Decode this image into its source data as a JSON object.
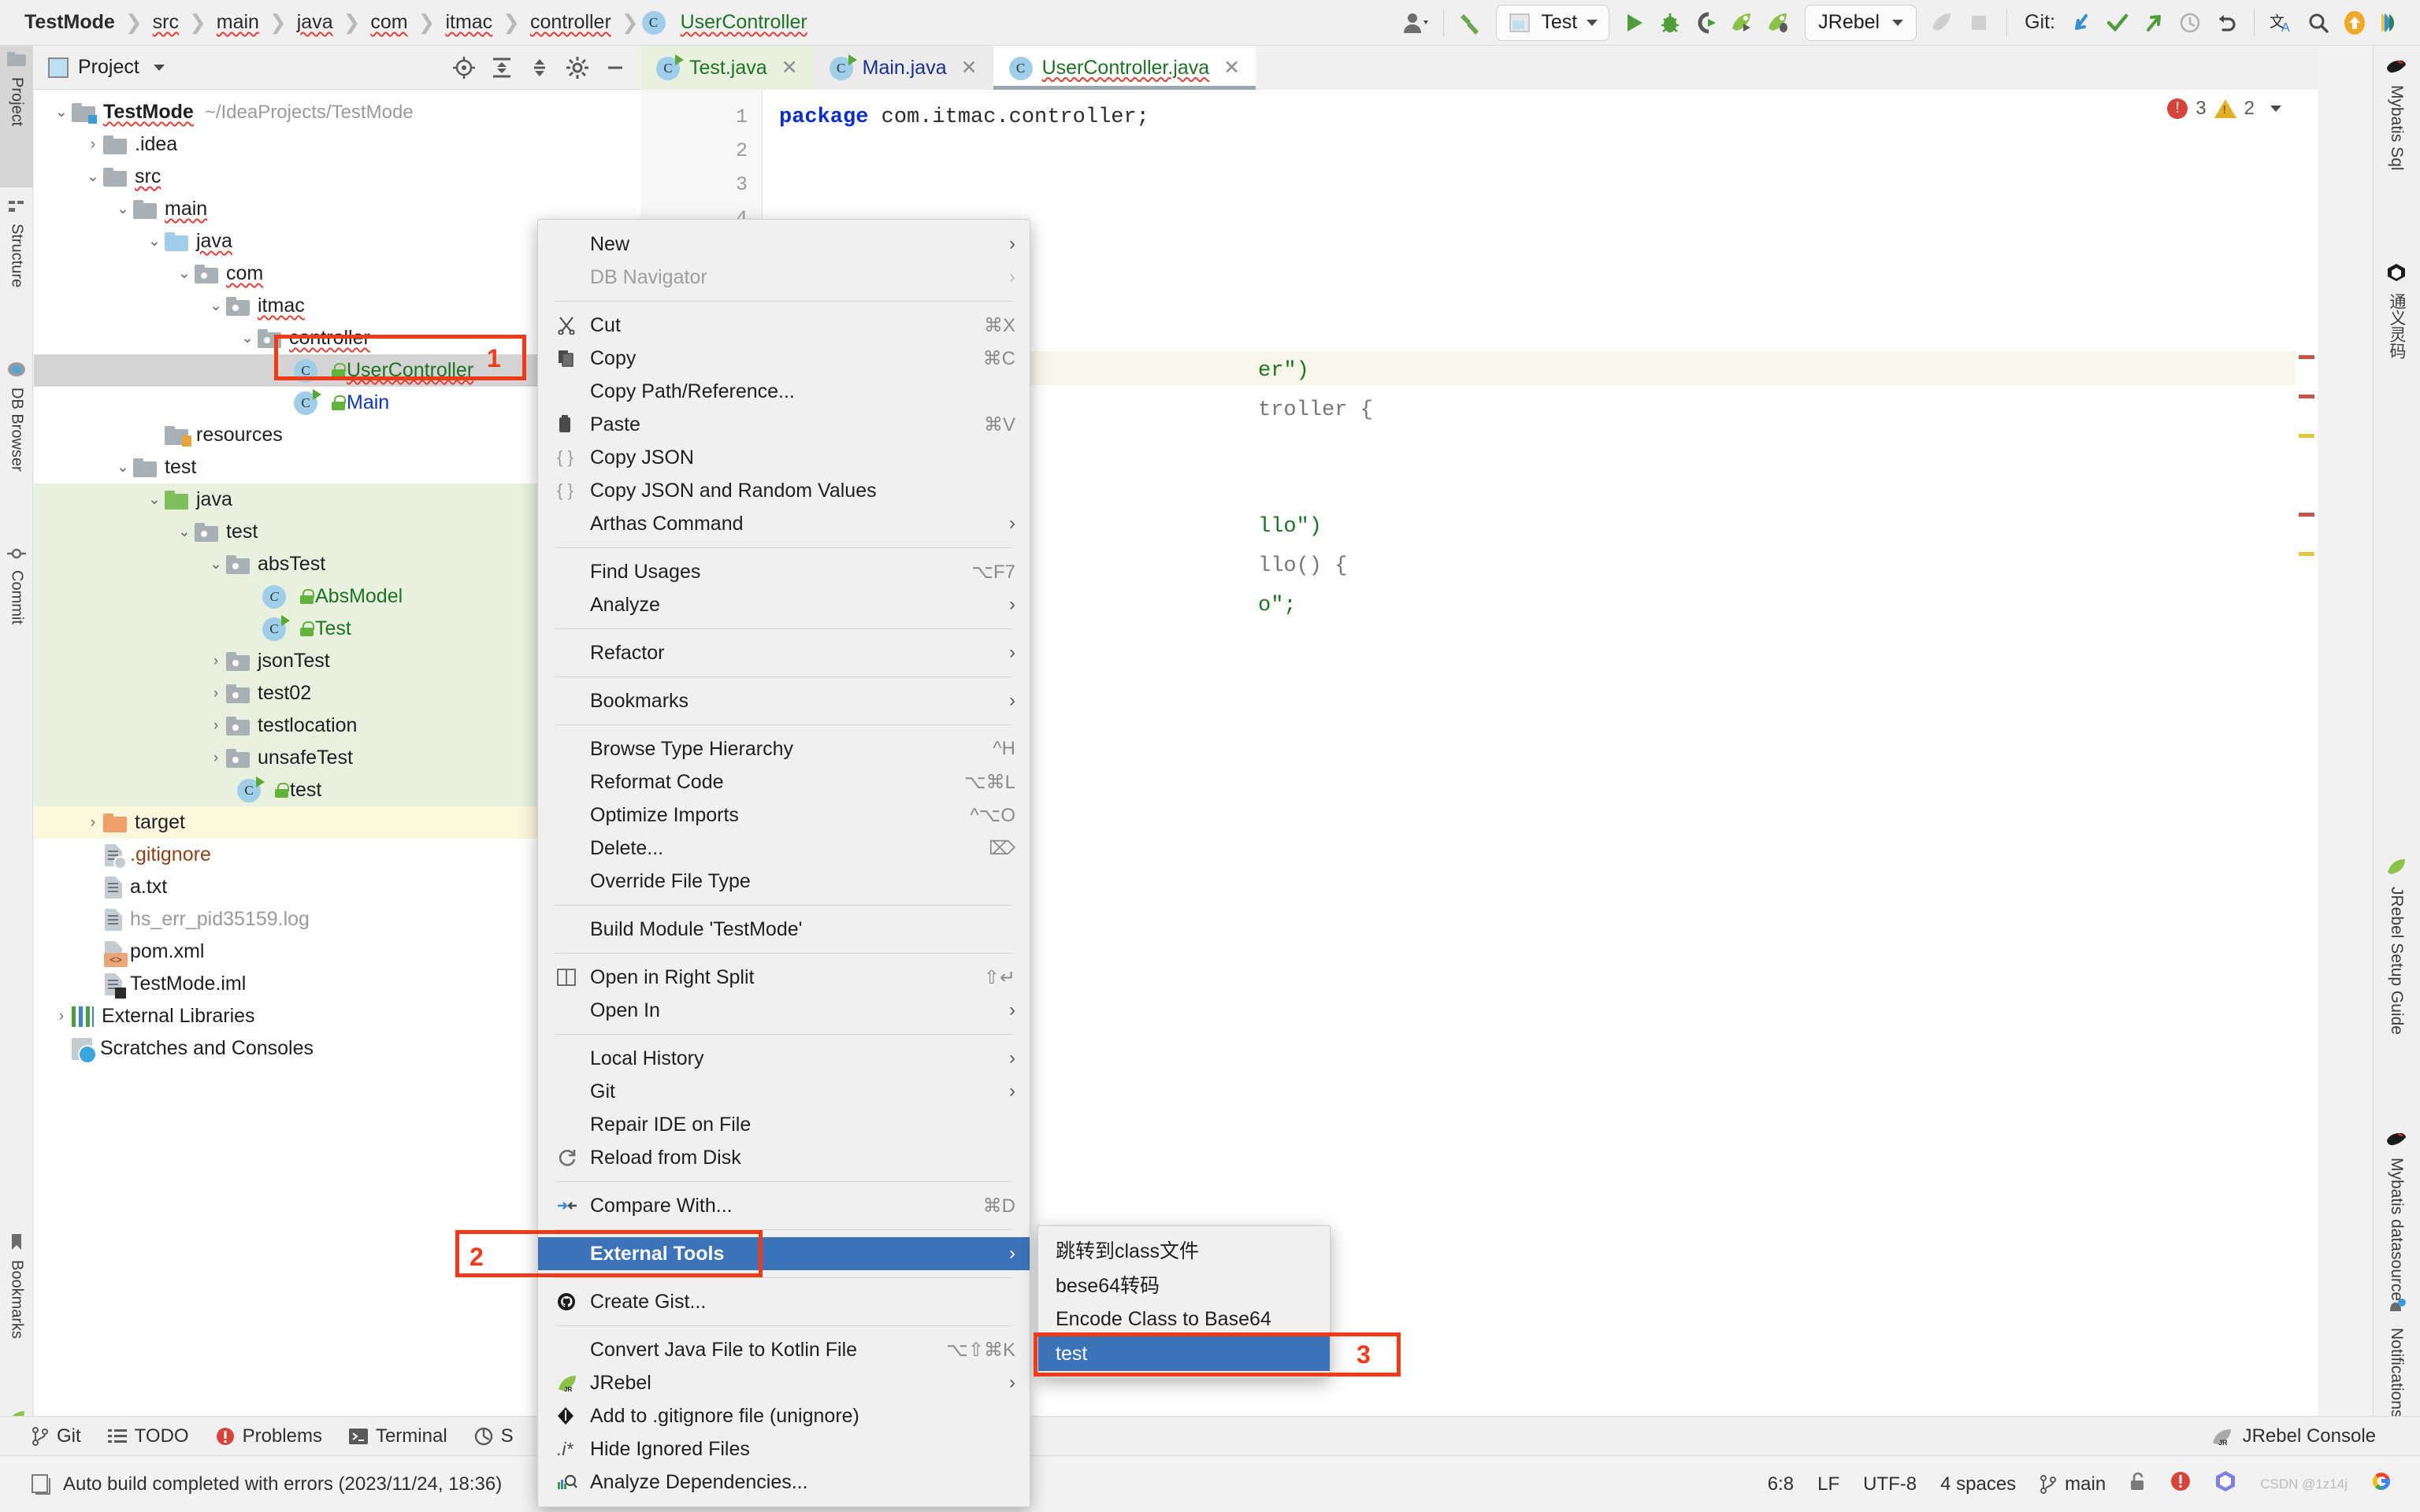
{
  "breadcrumbs": [
    {
      "label": "TestMode",
      "style": "project"
    },
    {
      "label": "src",
      "style": "squig"
    },
    {
      "label": "main",
      "style": "squig"
    },
    {
      "label": "java",
      "style": "squig"
    },
    {
      "label": "com",
      "style": "squig"
    },
    {
      "label": "itmac",
      "style": "squig"
    },
    {
      "label": "controller",
      "style": "squig"
    },
    {
      "label": "UserController",
      "style": "green-squig"
    }
  ],
  "toolbar": {
    "run_config_label": "Test",
    "jrebel_label": "JRebel",
    "git_label": "Git:",
    "icons": [
      "user-avatar-icon",
      "hammer-build-icon",
      "run-config-icon",
      "run-icon",
      "debug-icon",
      "run-coverage-icon",
      "jrebel-run-icon",
      "jrebel-debug-icon",
      "jrebel-disabled-icon",
      "stop-icon",
      "git-update-icon",
      "git-commit-icon",
      "git-push-icon",
      "git-history-icon",
      "git-rollback-icon",
      "translate-icon",
      "search-everywhere-icon",
      "update-available-icon",
      "ide-feature-icon"
    ]
  },
  "left_rail": [
    {
      "label": "Project",
      "icon": "project-icon",
      "selected": true
    },
    {
      "label": "Structure",
      "icon": "structure-icon",
      "selected": false
    },
    {
      "label": "DB Browser",
      "icon": "db-browser-icon",
      "selected": false
    },
    {
      "label": "Commit",
      "icon": "commit-icon",
      "selected": false
    },
    {
      "label": "Bookmarks",
      "icon": "bookmarks-icon",
      "selected": false
    },
    {
      "label": "JRebel",
      "icon": "jrebel-icon",
      "selected": false
    }
  ],
  "right_rail": [
    {
      "label": "Mybatis Sql",
      "icon": "mybatis-icon"
    },
    {
      "label": "通义灵码",
      "icon": "tongyi-icon"
    },
    {
      "label": "JRebel Setup Guide",
      "icon": "jrebel-icon"
    },
    {
      "label": "Mybatis datasource",
      "icon": "mybatis-icon"
    },
    {
      "label": "Notifications",
      "icon": "notifications-icon"
    }
  ],
  "project_panel": {
    "title": "Project",
    "header_icons": [
      "locate-icon",
      "expand-all-icon",
      "collapse-all-icon",
      "settings-icon",
      "hide-icon",
      "more-options-icon"
    ],
    "tree": [
      {
        "depth": 0,
        "label": "TestMode",
        "suffix": "~/IdeaProjects/TestMode",
        "icon": "project-folder-icon",
        "arrow": "down",
        "style": "bold-squig",
        "band": "none"
      },
      {
        "depth": 1,
        "label": ".idea",
        "icon": "folder-icon",
        "arrow": "right",
        "style": "plain",
        "band": "none"
      },
      {
        "depth": 1,
        "label": "src",
        "icon": "folder-icon",
        "arrow": "down",
        "style": "squig",
        "band": "none"
      },
      {
        "depth": 2,
        "label": "main",
        "icon": "folder-icon",
        "arrow": "down",
        "style": "squig",
        "band": "none"
      },
      {
        "depth": 3,
        "label": "java",
        "icon": "source-folder-icon",
        "arrow": "down",
        "style": "squig",
        "band": "none"
      },
      {
        "depth": 4,
        "label": "com",
        "icon": "package-icon",
        "arrow": "down",
        "style": "squig",
        "band": "none"
      },
      {
        "depth": 5,
        "label": "itmac",
        "icon": "package-icon",
        "arrow": "down",
        "style": "squig",
        "band": "none"
      },
      {
        "depth": 6,
        "label": "controller",
        "icon": "package-icon",
        "arrow": "down",
        "style": "squig",
        "band": "none"
      },
      {
        "depth": 7,
        "label": "UserController",
        "icon": "java-class-icon",
        "arrow": "none",
        "style": "green-squig",
        "band": "selected"
      },
      {
        "depth": 7,
        "label": "Main",
        "icon": "java-runnable-class-icon",
        "arrow": "none",
        "style": "blue",
        "band": "none"
      },
      {
        "depth": 3,
        "label": "resources",
        "icon": "resources-folder-icon",
        "arrow": "none",
        "style": "plain",
        "band": "none"
      },
      {
        "depth": 2,
        "label": "test",
        "icon": "folder-icon",
        "arrow": "down",
        "style": "plain",
        "band": "none"
      },
      {
        "depth": 3,
        "label": "java",
        "icon": "test-source-folder-icon",
        "arrow": "down",
        "style": "plain",
        "band": "green"
      },
      {
        "depth": 4,
        "label": "test",
        "icon": "package-icon",
        "arrow": "down",
        "style": "plain",
        "band": "green"
      },
      {
        "depth": 5,
        "label": "absTest",
        "icon": "package-icon",
        "arrow": "down",
        "style": "plain",
        "band": "green"
      },
      {
        "depth": 6,
        "label": "AbsModel",
        "icon": "abstract-class-icon",
        "arrow": "none",
        "style": "green",
        "band": "green"
      },
      {
        "depth": 6,
        "label": "Test",
        "icon": "java-runnable-class-icon",
        "arrow": "none",
        "style": "green",
        "band": "green"
      },
      {
        "depth": 5,
        "label": "jsonTest",
        "icon": "package-icon",
        "arrow": "right",
        "style": "plain",
        "band": "green"
      },
      {
        "depth": 5,
        "label": "test02",
        "icon": "package-icon",
        "arrow": "right",
        "style": "plain",
        "band": "green"
      },
      {
        "depth": 5,
        "label": "testlocation",
        "icon": "package-icon",
        "arrow": "right",
        "style": "plain",
        "band": "green"
      },
      {
        "depth": 5,
        "label": "unsafeTest",
        "icon": "package-icon",
        "arrow": "right",
        "style": "plain",
        "band": "green"
      },
      {
        "depth": 5,
        "label": "test",
        "icon": "java-runnable-class-icon",
        "arrow": "none",
        "style": "plain",
        "band": "green"
      },
      {
        "depth": 1,
        "label": "target",
        "icon": "target-folder-icon",
        "arrow": "right",
        "style": "plain",
        "band": "yellow"
      },
      {
        "depth": 1,
        "label": ".gitignore",
        "icon": "gitignore-file-icon",
        "arrow": "none",
        "style": "brown",
        "band": "none"
      },
      {
        "depth": 1,
        "label": "a.txt",
        "icon": "text-file-icon",
        "arrow": "none",
        "style": "plain",
        "band": "none"
      },
      {
        "depth": 1,
        "label": "hs_err_pid35159.log",
        "icon": "log-file-icon",
        "arrow": "none",
        "style": "grey",
        "band": "none"
      },
      {
        "depth": 1,
        "label": "pom.xml",
        "icon": "maven-file-icon",
        "arrow": "none",
        "style": "plain",
        "band": "none"
      },
      {
        "depth": 1,
        "label": "TestMode.iml",
        "icon": "iml-file-icon",
        "arrow": "none",
        "style": "plain",
        "band": "none"
      },
      {
        "depth": 0,
        "label": "External Libraries",
        "icon": "libraries-icon",
        "arrow": "right",
        "style": "plain",
        "band": "none"
      },
      {
        "depth": 0,
        "label": "Scratches and Consoles",
        "icon": "scratches-icon",
        "arrow": "none",
        "style": "plain",
        "band": "none"
      }
    ]
  },
  "editor": {
    "tabs": [
      {
        "label": "Test.java",
        "icon": "java-runnable-class-icon",
        "state": "green",
        "active": false
      },
      {
        "label": "Main.java",
        "icon": "java-runnable-class-icon",
        "state": "blue",
        "active": false
      },
      {
        "label": "UserController.java",
        "icon": "java-class-icon",
        "state": "green-squig",
        "active": true
      }
    ],
    "line_numbers": [
      "1",
      "2",
      "3",
      "4"
    ],
    "code_lines": [
      {
        "text": "package com.itmac.controller;",
        "kw": "package"
      },
      {
        "text": "er\")"
      },
      {
        "text": "troller {"
      },
      {
        "text": "llo\")"
      },
      {
        "text": "llo() {"
      },
      {
        "text": "o\";"
      }
    ],
    "inspection": {
      "errors": "3",
      "warnings": "2"
    }
  },
  "context_menu": {
    "items": [
      {
        "label": "New",
        "submenu": true,
        "icon": "",
        "accel": "",
        "disabled": false
      },
      {
        "label": "DB Navigator",
        "submenu": true,
        "icon": "",
        "accel": "",
        "disabled": true
      },
      {
        "sep": true
      },
      {
        "label": "Cut",
        "submenu": false,
        "icon": "scissors-icon",
        "accel": "⌘X",
        "disabled": false
      },
      {
        "label": "Copy",
        "submenu": false,
        "icon": "copy-icon",
        "accel": "⌘C",
        "disabled": false
      },
      {
        "label": "Copy Path/Reference...",
        "submenu": false,
        "icon": "",
        "accel": "",
        "disabled": false
      },
      {
        "label": "Paste",
        "submenu": false,
        "icon": "clipboard-icon",
        "accel": "⌘V",
        "disabled": false
      },
      {
        "label": "Copy JSON",
        "submenu": false,
        "icon": "braces-icon",
        "accel": "",
        "disabled": false
      },
      {
        "label": "Copy JSON and Random Values",
        "submenu": false,
        "icon": "braces-icon",
        "accel": "",
        "disabled": false
      },
      {
        "label": "Arthas Command",
        "submenu": true,
        "icon": "",
        "accel": "",
        "disabled": false
      },
      {
        "sep": true
      },
      {
        "label": "Find Usages",
        "submenu": false,
        "icon": "",
        "accel": "⌥F7",
        "disabled": false
      },
      {
        "label": "Analyze",
        "submenu": true,
        "icon": "",
        "accel": "",
        "disabled": false
      },
      {
        "sep": true
      },
      {
        "label": "Refactor",
        "submenu": true,
        "icon": "",
        "accel": "",
        "disabled": false
      },
      {
        "sep": true
      },
      {
        "label": "Bookmarks",
        "submenu": true,
        "icon": "",
        "accel": "",
        "disabled": false
      },
      {
        "sep": true
      },
      {
        "label": "Browse Type Hierarchy",
        "submenu": false,
        "icon": "",
        "accel": "^H",
        "disabled": false
      },
      {
        "label": "Reformat Code",
        "submenu": false,
        "icon": "",
        "accel": "⌥⌘L",
        "disabled": false
      },
      {
        "label": "Optimize Imports",
        "submenu": false,
        "icon": "",
        "accel": "^⌥O",
        "disabled": false
      },
      {
        "label": "Delete...",
        "submenu": false,
        "icon": "",
        "accel": "⌦",
        "disabled": false
      },
      {
        "label": "Override File Type",
        "submenu": false,
        "icon": "",
        "accel": "",
        "disabled": false
      },
      {
        "sep": true
      },
      {
        "label": "Build Module 'TestMode'",
        "submenu": false,
        "icon": "",
        "accel": "",
        "disabled": false
      },
      {
        "sep": true
      },
      {
        "label": "Open in Right Split",
        "submenu": false,
        "icon": "split-icon",
        "accel": "⇧↵",
        "disabled": false
      },
      {
        "label": "Open In",
        "submenu": true,
        "icon": "",
        "accel": "",
        "disabled": false
      },
      {
        "sep": true
      },
      {
        "label": "Local History",
        "submenu": true,
        "icon": "",
        "accel": "",
        "disabled": false
      },
      {
        "label": "Git",
        "submenu": true,
        "icon": "",
        "accel": "",
        "disabled": false
      },
      {
        "label": "Repair IDE on File",
        "submenu": false,
        "icon": "",
        "accel": "",
        "disabled": false
      },
      {
        "label": "Reload from Disk",
        "submenu": false,
        "icon": "reload-icon",
        "accel": "",
        "disabled": false
      },
      {
        "sep": true
      },
      {
        "label": "Compare With...",
        "submenu": false,
        "icon": "compare-icon",
        "accel": "⌘D",
        "disabled": false
      },
      {
        "sep": true
      },
      {
        "label": "External Tools",
        "submenu": true,
        "icon": "",
        "accel": "",
        "disabled": false,
        "highlighted": true
      },
      {
        "sep": true
      },
      {
        "label": "Create Gist...",
        "submenu": false,
        "icon": "github-icon",
        "accel": "",
        "disabled": false
      },
      {
        "sep": true
      },
      {
        "label": "Convert Java File to Kotlin File",
        "submenu": false,
        "icon": "",
        "accel": "⌥⇧⌘K",
        "disabled": false
      },
      {
        "label": "JRebel",
        "submenu": true,
        "icon": "jrebel-icon",
        "accel": "",
        "disabled": false
      },
      {
        "label": "Add to .gitignore file (unignore)",
        "submenu": false,
        "icon": "gitignore-icon",
        "accel": "",
        "disabled": false
      },
      {
        "label": "Hide Ignored Files",
        "submenu": false,
        "icon": "dot-i-star-icon",
        "accel": "",
        "disabled": false
      },
      {
        "label": "Analyze Dependencies...",
        "submenu": false,
        "icon": "analyze-dependencies-icon",
        "accel": "",
        "disabled": false
      }
    ]
  },
  "submenu": {
    "items": [
      {
        "label": "跳转到class文件",
        "highlighted": false
      },
      {
        "label": "bese64转码",
        "highlighted": false
      },
      {
        "label": "Encode Class to Base64",
        "highlighted": false
      },
      {
        "label": "test",
        "highlighted": true
      }
    ]
  },
  "annotations": [
    {
      "number": "1",
      "target": "user-controller-tree-row"
    },
    {
      "number": "2",
      "target": "external-tools-menu-item"
    },
    {
      "number": "3",
      "target": "submenu-test-item"
    }
  ],
  "bottom_bar": {
    "items": [
      {
        "label": "Git",
        "icon": "git-branch-icon"
      },
      {
        "label": "TODO",
        "icon": "todo-icon"
      },
      {
        "label": "Problems",
        "icon": "problems-icon"
      },
      {
        "label": "Terminal",
        "icon": "terminal-icon"
      },
      {
        "label": "S",
        "icon": "services-icon"
      }
    ],
    "right_label": "JRebel Console",
    "right_icon": "jrebel-icon"
  },
  "status_bar": {
    "message": "Auto build completed with errors (2023/11/24, 18:36)",
    "message_icon": "build-icon",
    "caret": "6:8",
    "line_sep": "LF",
    "encoding": "UTF-8",
    "indent": "4 spaces",
    "branch": "main",
    "branch_icon": "git-branch-icon",
    "icons": [
      "unlock-icon",
      "problems-icon",
      "tongyi-icon",
      "google-icon"
    ],
    "watermark": "CSDN @1z14j"
  },
  "colors": {
    "accent_blue": "#3b72b8",
    "annotation_red": "#ef3b17",
    "green_text": "#1d7324",
    "band_green": "#e7f1de",
    "band_yellow": "#fcf6dd"
  }
}
